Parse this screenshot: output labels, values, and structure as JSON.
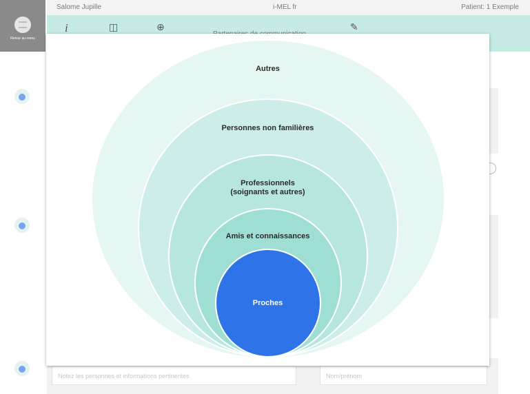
{
  "header": {
    "user": "Salome Jupille",
    "app": "i-MEL fr",
    "patient": "Patient: 1 Exemple"
  },
  "nav": {
    "menu_label": "Retour au menu"
  },
  "toolbar": {
    "title": "Partenaires de communication",
    "icons": [
      "info-icon",
      "book-icon",
      "zoom-icon",
      "edit-icon"
    ]
  },
  "background": {
    "field_left_placeholder": "Notez les personnes et informations pertinentes",
    "field_right_placeholder": "Nom/prénom"
  },
  "diagram": {
    "rings": [
      {
        "label": "Autres",
        "color": "#e6f6f3"
      },
      {
        "label": "Personnes non familières",
        "color": "#cdeee8"
      },
      {
        "label": "Professionnels\n(soignants et autres)",
        "color": "#b6e6de"
      },
      {
        "label": "Amis et connaissances",
        "color": "#9fded3"
      },
      {
        "label": "Proches",
        "color": "#2e74e8"
      }
    ]
  }
}
